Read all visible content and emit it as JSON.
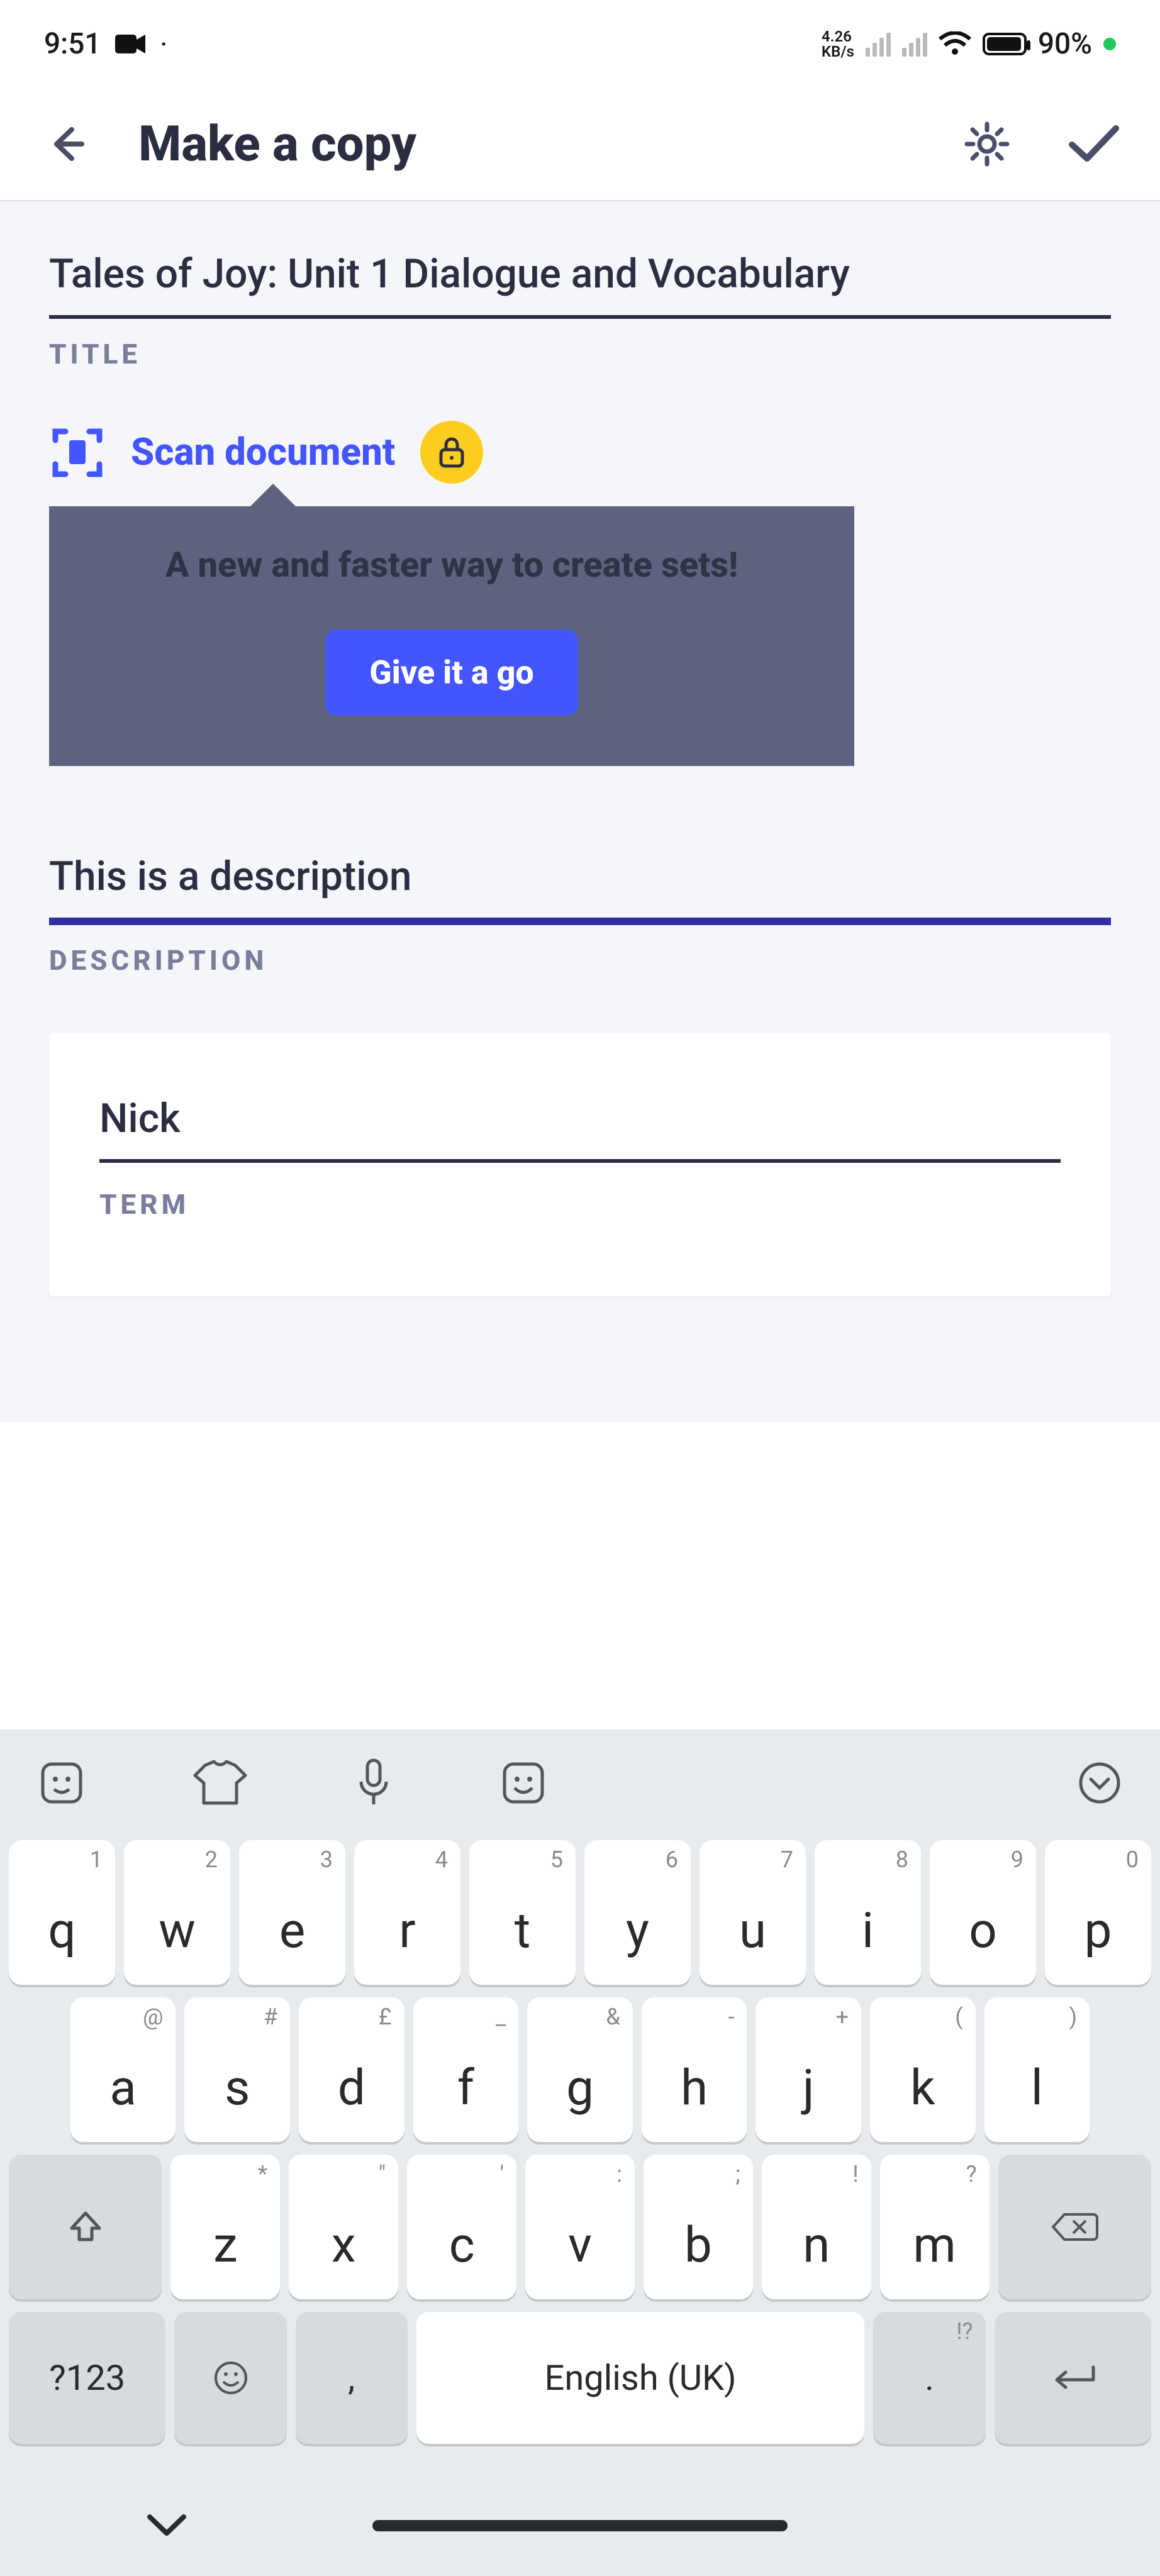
{
  "status": {
    "time": "9:51",
    "net_speed_value": "4.26",
    "net_speed_unit": "KB/s",
    "battery_percent": "90%"
  },
  "header": {
    "title": "Make a copy"
  },
  "form": {
    "title_value": "Tales of Joy: Unit 1 Dialogue and Vocabulary",
    "title_label": "TITLE",
    "scan_label": "Scan document",
    "popover_message": "A new and faster way to create sets!",
    "popover_cta": "Give it a go",
    "description_value": "This is a description",
    "description_label": "DESCRIPTION",
    "term_value": "Nick",
    "term_label": "TERM"
  },
  "keyboard": {
    "row1": [
      {
        "k": "q",
        "a": "1"
      },
      {
        "k": "w",
        "a": "2"
      },
      {
        "k": "e",
        "a": "3"
      },
      {
        "k": "r",
        "a": "4"
      },
      {
        "k": "t",
        "a": "5"
      },
      {
        "k": "y",
        "a": "6"
      },
      {
        "k": "u",
        "a": "7"
      },
      {
        "k": "i",
        "a": "8"
      },
      {
        "k": "o",
        "a": "9"
      },
      {
        "k": "p",
        "a": "0"
      }
    ],
    "row2": [
      {
        "k": "a",
        "a": "@"
      },
      {
        "k": "s",
        "a": "#"
      },
      {
        "k": "d",
        "a": "£"
      },
      {
        "k": "f",
        "a": "_"
      },
      {
        "k": "g",
        "a": "&"
      },
      {
        "k": "h",
        "a": "-"
      },
      {
        "k": "j",
        "a": "+"
      },
      {
        "k": "k",
        "a": "("
      },
      {
        "k": "l",
        "a": ")"
      }
    ],
    "row3": [
      {
        "k": "z",
        "a": "*"
      },
      {
        "k": "x",
        "a": "\""
      },
      {
        "k": "c",
        "a": "'"
      },
      {
        "k": "v",
        "a": ":"
      },
      {
        "k": "b",
        "a": ";"
      },
      {
        "k": "n",
        "a": "!"
      },
      {
        "k": "m",
        "a": "?"
      }
    ],
    "symbols_key": "?123",
    "comma_key": ",",
    "space_label": "English (UK)",
    "period_key": ".",
    "period_alt": "!?"
  }
}
